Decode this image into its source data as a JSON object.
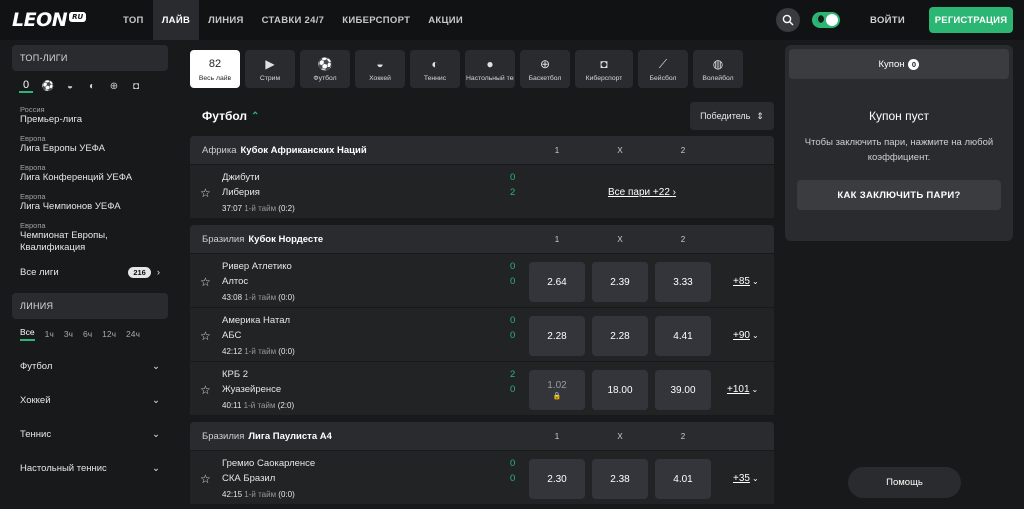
{
  "logo": {
    "text": "LEON",
    "badge": "RU"
  },
  "nav": [
    "ТОП",
    "ЛАЙВ",
    "ЛИНИЯ",
    "СТАВКИ 24/7",
    "КИБЕРСПОРТ",
    "АКЦИИ"
  ],
  "header": {
    "login": "ВОЙТИ",
    "register": "РЕГИСТРАЦИЯ"
  },
  "sidebar": {
    "top_leagues_title": "ТОП-ЛИГИ",
    "top_leagues_count": "0",
    "leagues": [
      {
        "country": "Россия",
        "name": "Премьер-лига"
      },
      {
        "country": "Европа",
        "name": "Лига Европы УЕФА"
      },
      {
        "country": "Европа",
        "name": "Лига Конференций УЕФА"
      },
      {
        "country": "Европа",
        "name": "Лига Чемпионов УЕФА"
      },
      {
        "country": "Европа",
        "name": "Чемпионат Европы, Квалификация"
      }
    ],
    "all_leagues_label": "Все лиги",
    "all_leagues_count": "216",
    "line_title": "ЛИНИЯ",
    "periods": [
      "Все",
      "1ч",
      "3ч",
      "6ч",
      "12ч",
      "24ч"
    ],
    "sports": [
      "Футбол",
      "Хоккей",
      "Теннис",
      "Настольный теннис"
    ]
  },
  "sport_tabs": [
    {
      "icon": "82",
      "label": "Весь лайв"
    },
    {
      "icon": "stream-icon",
      "label": "Стрим"
    },
    {
      "icon": "football-icon",
      "label": "Футбол"
    },
    {
      "icon": "hockey-icon",
      "label": "Хоккей"
    },
    {
      "icon": "tennis-icon",
      "label": "Теннис"
    },
    {
      "icon": "table-tennis-icon",
      "label": "Настольный теннис"
    },
    {
      "icon": "basketball-icon",
      "label": "Баскетбол"
    },
    {
      "icon": "esports-icon",
      "label": "Киберспорт"
    },
    {
      "icon": "baseball-icon",
      "label": "Бейсбол"
    },
    {
      "icon": "volleyball-icon",
      "label": "Волейбол"
    }
  ],
  "main": {
    "section_title": "Футбол",
    "market_select": "Победитель",
    "col_labels": [
      "1",
      "X",
      "2"
    ],
    "blocks": [
      {
        "country": "Африка",
        "league": "Кубок Африканских Наций",
        "matches": [
          {
            "team1": "Джибути",
            "team2": "Либерия",
            "score1": "0",
            "score2": "2",
            "time": "37:07",
            "half": "1-й тайм",
            "period_score": "(0:2)",
            "all_pairs": "Все пари +22"
          }
        ]
      },
      {
        "country": "Бразилия",
        "league": "Кубок Нордесте",
        "matches": [
          {
            "team1": "Ривер Атлетико",
            "team2": "Алтос",
            "score1": "0",
            "score2": "0",
            "time": "43:08",
            "half": "1-й тайм",
            "period_score": "(0:0)",
            "odds": [
              "2.64",
              "2.39",
              "3.33"
            ],
            "more": "+85"
          },
          {
            "team1": "Америка Натал",
            "team2": "АБС",
            "score1": "0",
            "score2": "0",
            "time": "42:12",
            "half": "1-й тайм",
            "period_score": "(0:0)",
            "odds": [
              "2.28",
              "2.28",
              "4.41"
            ],
            "more": "+90"
          },
          {
            "team1": "КРБ 2",
            "team2": "Жуазейренсе",
            "score1": "2",
            "score2": "0",
            "time": "40:11",
            "half": "1-й тайм",
            "period_score": "(2:0)",
            "odds": [
              "1.02",
              "18.00",
              "39.00"
            ],
            "more": "+101"
          }
        ]
      },
      {
        "country": "Бразилия",
        "league": "Лига Паулиста А4",
        "matches": [
          {
            "team1": "Гремио Саокарленсе",
            "team2": "СКА Бразил",
            "score1": "0",
            "score2": "0",
            "time": "42:15",
            "half": "1-й тайм",
            "period_score": "(0:0)",
            "odds": [
              "2.30",
              "2.38",
              "4.01"
            ],
            "more": "+35"
          }
        ]
      }
    ]
  },
  "coupon": {
    "tab_label": "Купон",
    "count": "0",
    "empty_title": "Купон пуст",
    "hint": "Чтобы заключить пари, нажмите на любой коэффициент.",
    "how_button": "КАК ЗАКЛЮЧИТЬ ПАРИ?"
  },
  "help_button": "Помощь",
  "colors": {
    "accent": "#2bb673",
    "background": "#18191b",
    "panel": "#2a2b2e"
  }
}
